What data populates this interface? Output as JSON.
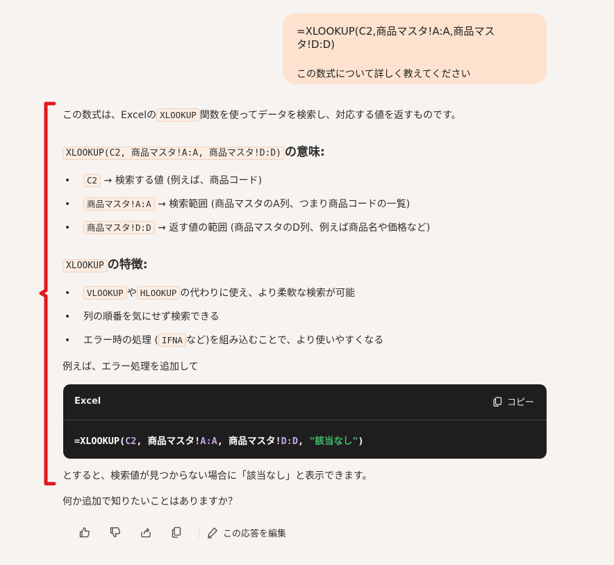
{
  "user_message": {
    "line1": "=XLOOKUP(C2,商品マスタ!A:A,商品マスタ!D:D)",
    "line2": "この数式について詳しく教えてください"
  },
  "response": {
    "intro_pre": "この数式は、Excelの",
    "intro_code": "XLOOKUP",
    "intro_post": "関数を使ってデータを検索し、対応する値を返すものです。",
    "heading1_code": "XLOOKUP(C2, 商品マスタ!A:A, 商品マスタ!D:D)",
    "heading1_text": "の意味:",
    "meaning_items": [
      {
        "code": "C2",
        "text": "→ 検索する値 (例えば、商品コード)"
      },
      {
        "code": "商品マスタ!A:A",
        "text": "→ 検索範囲 (商品マスタのA列、つまり商品コードの一覧)"
      },
      {
        "code": "商品マスタ!D:D",
        "text": "→ 返す値の範囲 (商品マスタのD列、例えば商品名や価格など)"
      }
    ],
    "heading2_code": "XLOOKUP",
    "heading2_text": "の特徴:",
    "feature1_code_a": "VLOOKUP",
    "feature1_mid": "や",
    "feature1_code_b": "HLOOKUP",
    "feature1_text": "の代わりに使え、より柔軟な検索が可能",
    "feature2_text": "列の順番を気にせず検索できる",
    "feature3_pre": "エラー時の処理 (",
    "feature3_code": "IFNA",
    "feature3_post": "など)を組み込むことで、より使いやすくなる",
    "example_intro": "例えば、エラー処理を追加して",
    "code_block": {
      "language": "Excel",
      "copy_label": "コピー",
      "tokens": {
        "t1": "=XLOOKUP(",
        "t2": "C2",
        "t3": ", 商品マスタ!",
        "t4": "A:A",
        "t5": ", 商品マスタ!",
        "t6": "D:D",
        "t7": ", ",
        "t8": "\"該当なし\"",
        "t9": ")"
      }
    },
    "after_code": "とすると、検索値が見つからない場合に「該当なし」と表示できます。",
    "closing": "何か追加で知りたいことはありますか？"
  },
  "actions": {
    "edit_label": "この応答を編集"
  },
  "colors": {
    "user_bubble": "#fde3cf",
    "bracket": "#e0191c",
    "code_bg": "#1f1e1e",
    "code_string": "#3fbf6f",
    "code_ref": "#c7a4e8"
  }
}
